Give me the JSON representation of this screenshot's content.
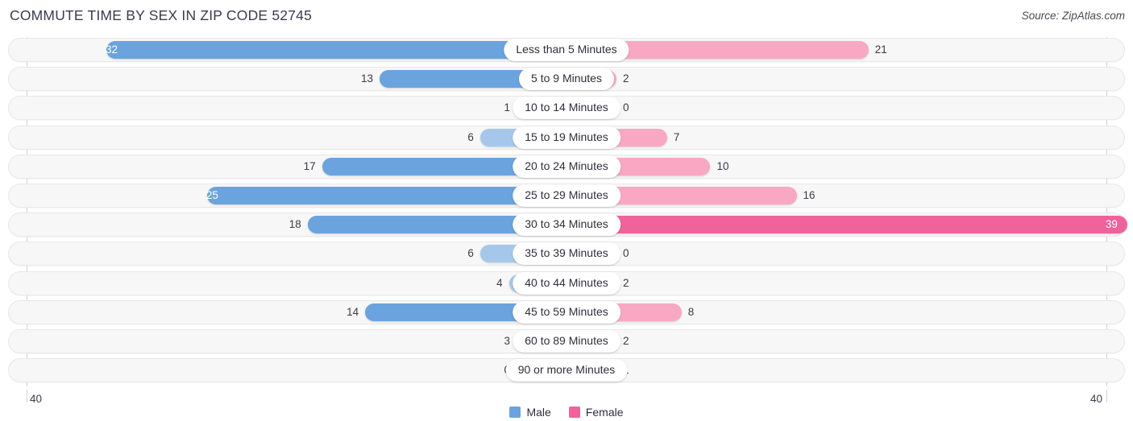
{
  "header": {
    "title": "COMMUTE TIME BY SEX IN ZIP CODE 52745",
    "source": "Source: ZipAtlas.com"
  },
  "legend": {
    "items": [
      {
        "label": "Male",
        "color": "#6ba3de"
      },
      {
        "label": "Female",
        "color": "#f0629b"
      }
    ]
  },
  "axis": {
    "left_label": "40",
    "right_label": "40",
    "max": 40
  },
  "colors": {
    "male_strong": "#6ba3de",
    "male_light": "#a5c8ea",
    "female_strong": "#f0629b",
    "female_light": "#f9a8c4",
    "track_fill": "#f7f7f7",
    "track_border": "#e8e8e8"
  },
  "chart_data": {
    "type": "bar",
    "orientation": "horizontal-diverging",
    "title": "COMMUTE TIME BY SEX IN ZIP CODE 52745",
    "xlabel": "",
    "ylabel": "",
    "xlim": [
      40,
      40
    ],
    "grid": false,
    "legend_position": "bottom-center",
    "categories": [
      "Less than 5 Minutes",
      "5 to 9 Minutes",
      "10 to 14 Minutes",
      "15 to 19 Minutes",
      "20 to 24 Minutes",
      "25 to 29 Minutes",
      "30 to 34 Minutes",
      "35 to 39 Minutes",
      "40 to 44 Minutes",
      "45 to 59 Minutes",
      "60 to 89 Minutes",
      "90 or more Minutes"
    ],
    "series": [
      {
        "name": "Male",
        "values": [
          32,
          13,
          1,
          6,
          17,
          25,
          18,
          6,
          4,
          14,
          3,
          0
        ]
      },
      {
        "name": "Female",
        "values": [
          21,
          2,
          0,
          7,
          10,
          16,
          39,
          0,
          2,
          8,
          2,
          1
        ]
      }
    ]
  },
  "rows": [
    {
      "label": "Less than 5 Minutes",
      "male": 32,
      "female": 21,
      "male_text": "32",
      "female_text": "21"
    },
    {
      "label": "5 to 9 Minutes",
      "male": 13,
      "female": 2,
      "male_text": "13",
      "female_text": "2"
    },
    {
      "label": "10 to 14 Minutes",
      "male": 1,
      "female": 0,
      "male_text": "1",
      "female_text": "0"
    },
    {
      "label": "15 to 19 Minutes",
      "male": 6,
      "female": 7,
      "male_text": "6",
      "female_text": "7"
    },
    {
      "label": "20 to 24 Minutes",
      "male": 17,
      "female": 10,
      "male_text": "17",
      "female_text": "10"
    },
    {
      "label": "25 to 29 Minutes",
      "male": 25,
      "female": 16,
      "male_text": "25",
      "female_text": "16"
    },
    {
      "label": "30 to 34 Minutes",
      "male": 18,
      "female": 39,
      "male_text": "18",
      "female_text": "39"
    },
    {
      "label": "35 to 39 Minutes",
      "male": 6,
      "female": 0,
      "male_text": "6",
      "female_text": "0"
    },
    {
      "label": "40 to 44 Minutes",
      "male": 4,
      "female": 2,
      "male_text": "4",
      "female_text": "2"
    },
    {
      "label": "45 to 59 Minutes",
      "male": 14,
      "female": 8,
      "male_text": "14",
      "female_text": "8"
    },
    {
      "label": "60 to 89 Minutes",
      "male": 3,
      "female": 2,
      "male_text": "3",
      "female_text": "2"
    },
    {
      "label": "90 or more Minutes",
      "male": 0,
      "female": 1,
      "male_text": "0",
      "female_text": "1"
    }
  ]
}
